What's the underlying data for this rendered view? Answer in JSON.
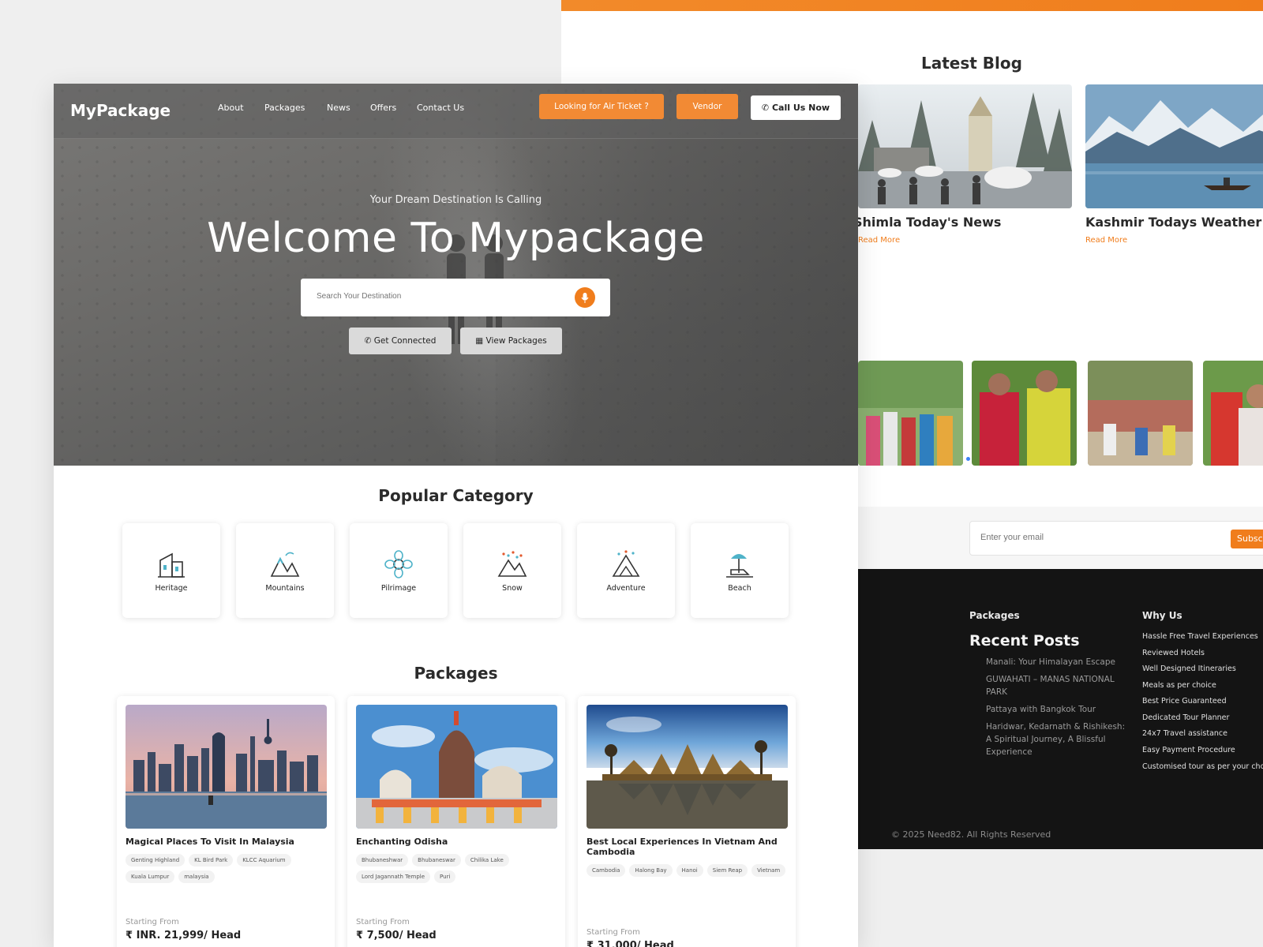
{
  "nav": {
    "logo": "MyPackage",
    "links": [
      "About",
      "Packages",
      "News",
      "Offers",
      "Contact Us"
    ],
    "air_ticket_button": "Looking for Air Ticket ?",
    "vendor_button": "Vendor",
    "call_button": "Call Us Now"
  },
  "hero": {
    "tagline": "Your Dream Destination Is Calling",
    "headline": "Welcome To Mypackage",
    "search_placeholder": "Search Your Destination",
    "get_connected": "Get Connected",
    "view_packages": "View Packages"
  },
  "popular_category": {
    "title": "Popular Category",
    "items": [
      {
        "label": "Heritage",
        "icon": "heritage-icon"
      },
      {
        "label": "Mountains",
        "icon": "mountains-icon"
      },
      {
        "label": "Pilrimage",
        "icon": "pilgrimage-icon"
      },
      {
        "label": "Snow",
        "icon": "snow-icon"
      },
      {
        "label": "Adventure",
        "icon": "adventure-icon"
      },
      {
        "label": "Beach",
        "icon": "beach-icon"
      }
    ]
  },
  "packages": {
    "title": "Packages",
    "items": [
      {
        "title": "Magical Places To Visit In Malaysia",
        "tags": [
          "Genting Highland",
          "KL Bird Park",
          "KLCC Aquarium",
          "Kuala Lumpur",
          "malaysia"
        ],
        "starting_label": "Starting From",
        "price": "₹ INR. 21,999/ Head"
      },
      {
        "title": "Enchanting Odisha",
        "tags": [
          "Bhubaneshwar",
          "Bhubaneswar",
          "Chilika Lake",
          "Lord Jagannath Temple",
          "Puri"
        ],
        "starting_label": "Starting From",
        "price": "₹ 7,500/ Head"
      },
      {
        "title": "Best Local Experiences In Vietnam And Cambodia",
        "tags": [
          "Cambodia",
          "Halong Bay",
          "Hanoi",
          "Siem Reap",
          "Vietnam"
        ],
        "starting_label": "Starting From",
        "price": "₹ 31,000/ Head"
      }
    ]
  },
  "blog": {
    "title": "Latest Blog",
    "posts": [
      {
        "title": "Shimla Today's News",
        "read_more": "Read More"
      },
      {
        "title": "Kashmir Todays Weather Ne",
        "read_more": "Read More"
      }
    ]
  },
  "newsletter": {
    "placeholder": "Enter your email",
    "button": "Subscri"
  },
  "footer": {
    "packages_title": "Packages",
    "why_title": "Why Us",
    "recent_title": "Recent Posts",
    "recent_posts": [
      "Manali: Your Himalayan Escape",
      "GUWAHATI – MANAS NATIONAL PARK",
      "Pattaya with Bangkok Tour",
      "Haridwar, Kedarnath & Rishikesh: A Spiritual Journey, A Blissful Experience"
    ],
    "why_items": [
      "Hassle Free Travel Experiences",
      "Reviewed Hotels",
      "Well Designed Itineraries",
      "Meals as per choice",
      "Best Price Guaranteed",
      "Dedicated Tour Planner",
      "24x7 Travel assistance",
      "Easy Payment Procedure",
      "Customised tour as per your cho"
    ],
    "copyright": "© 2025 Need82. All Rights Reserved"
  },
  "colors": {
    "accent": "#f07d1c",
    "footer_bg": "#141414"
  }
}
